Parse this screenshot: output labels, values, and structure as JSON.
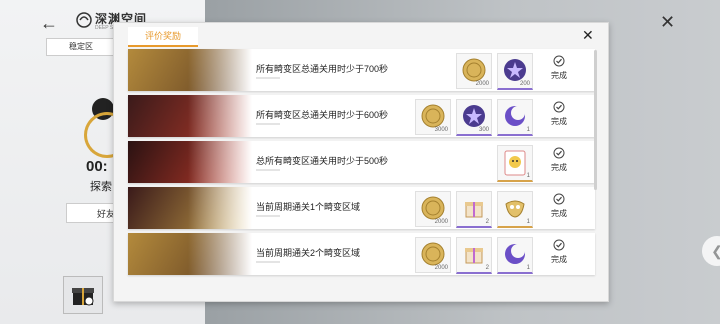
{
  "background": {
    "app_title": "深渊空间",
    "app_subtitle": "DEEP SP",
    "zone_tab": "稳定区",
    "timer": "00:",
    "explore_label": "探索",
    "friend_label": "好友"
  },
  "panel": {
    "tab_label": "评价奖励",
    "accent_color": "#e89a2c"
  },
  "rows": [
    {
      "description": "所有畸变区总通关用时少于700秒",
      "rewards": [
        {
          "icon": "gold-coin-icon",
          "qty": "2000"
        },
        {
          "icon": "purple-star-orb-icon",
          "qty": "200"
        }
      ],
      "status": "完成"
    },
    {
      "description": "所有畸变区总通关用时少于600秒",
      "rewards": [
        {
          "icon": "gold-coin-icon",
          "qty": "3000"
        },
        {
          "icon": "purple-star-orb-icon",
          "qty": "300"
        },
        {
          "icon": "purple-moon-icon",
          "qty": "1"
        }
      ],
      "status": "完成"
    },
    {
      "description": "总所有畸变区通关用时少于500秒",
      "rewards": [
        {
          "icon": "smiley-card-icon",
          "qty": "1"
        }
      ],
      "status": "完成"
    },
    {
      "description": "当前周期通关1个畸变区域",
      "rewards": [
        {
          "icon": "gold-coin-icon",
          "qty": "2000"
        },
        {
          "icon": "gift-box-icon",
          "qty": "2"
        },
        {
          "icon": "golden-mask-icon",
          "qty": "1"
        }
      ],
      "status": "完成"
    },
    {
      "description": "当前周期通关2个畸变区域",
      "rewards": [
        {
          "icon": "gold-coin-icon",
          "qty": "2000"
        },
        {
          "icon": "gift-box-icon",
          "qty": "2"
        },
        {
          "icon": "purple-moon-icon",
          "qty": "1"
        }
      ],
      "status": "完成"
    }
  ]
}
